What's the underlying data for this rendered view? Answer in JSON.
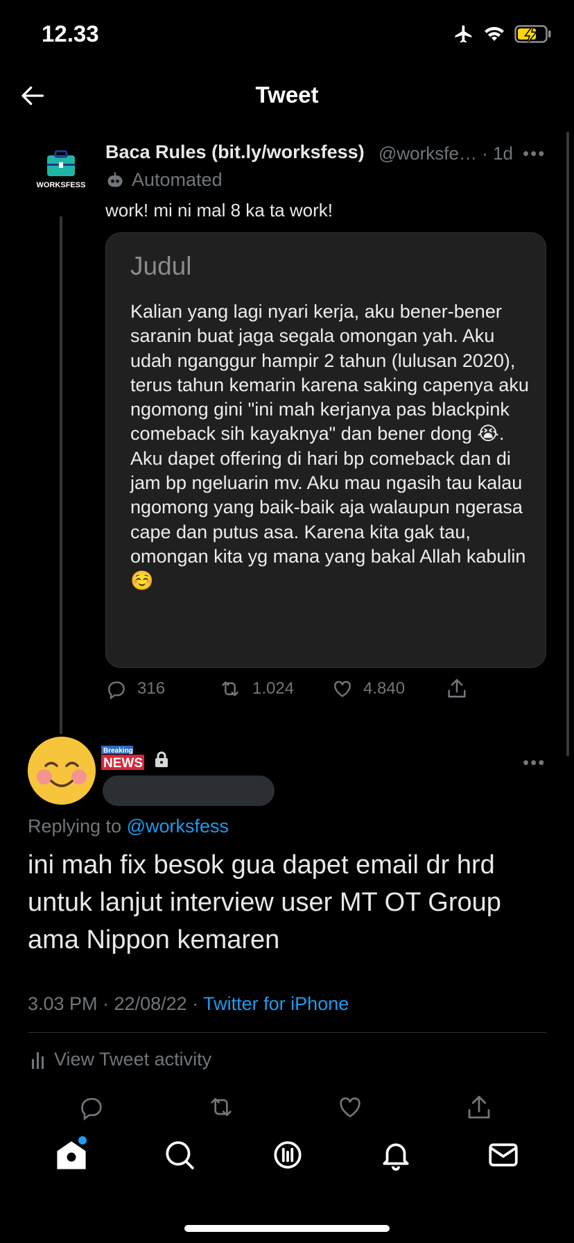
{
  "status": {
    "time": "12.33"
  },
  "header": {
    "title": "Tweet"
  },
  "tweet": {
    "display_name": "Baca Rules (bit.ly/worksfess)",
    "handle_time": "@worksfe… · 1d",
    "automated_label": "Automated",
    "text": "work! mi ni mal 8 ka ta work!",
    "logo_text": "WORKSFESS",
    "card": {
      "title": "Judul",
      "body": "Kalian yang lagi nyari kerja, aku bener-bener saranin buat jaga segala omongan yah. Aku udah nganggur hampir 2 tahun (lulusan 2020), terus tahun kemarin karena saking capenya aku ngomong gini \"ini mah kerjanya pas blackpink comeback sih kayaknya\" dan bener dong 😭. Aku dapet offering di hari bp comeback dan di jam bp ngeluarin mv. Aku mau ngasih tau kalau ngomong yang baik-baik aja walaupun ngerasa cape dan putus asa. Karena kita gak tau, omongan kita yg mana yang bakal Allah kabulin ☺️"
    },
    "replies": "316",
    "retweets": "1.024",
    "likes": "4.840"
  },
  "reply": {
    "badge_small": "Breaking",
    "badge_big": "NEWS",
    "replying_prefix": "Replying to",
    "replying_handle": "@worksfess",
    "text": "ini mah fix besok gua dapet email dr hrd untuk lanjut interview user MT OT Group ama Nippon kemaren",
    "timestamp": "3.03 PM · 22/08/22 · ",
    "source": "Twitter for iPhone",
    "activity_label": "View Tweet activity"
  },
  "colors": {
    "link": "#1d9bf0",
    "muted": "#71767b",
    "battery": "#ffd60a"
  },
  "icons": [
    "airplane-icon",
    "wifi-icon",
    "battery-icon",
    "back-arrow-icon",
    "robot-icon",
    "reply-icon",
    "retweet-icon",
    "like-icon",
    "share-icon",
    "lock-icon",
    "activity-icon",
    "home-icon",
    "search-icon",
    "spaces-icon",
    "notifications-icon",
    "messages-icon"
  ]
}
